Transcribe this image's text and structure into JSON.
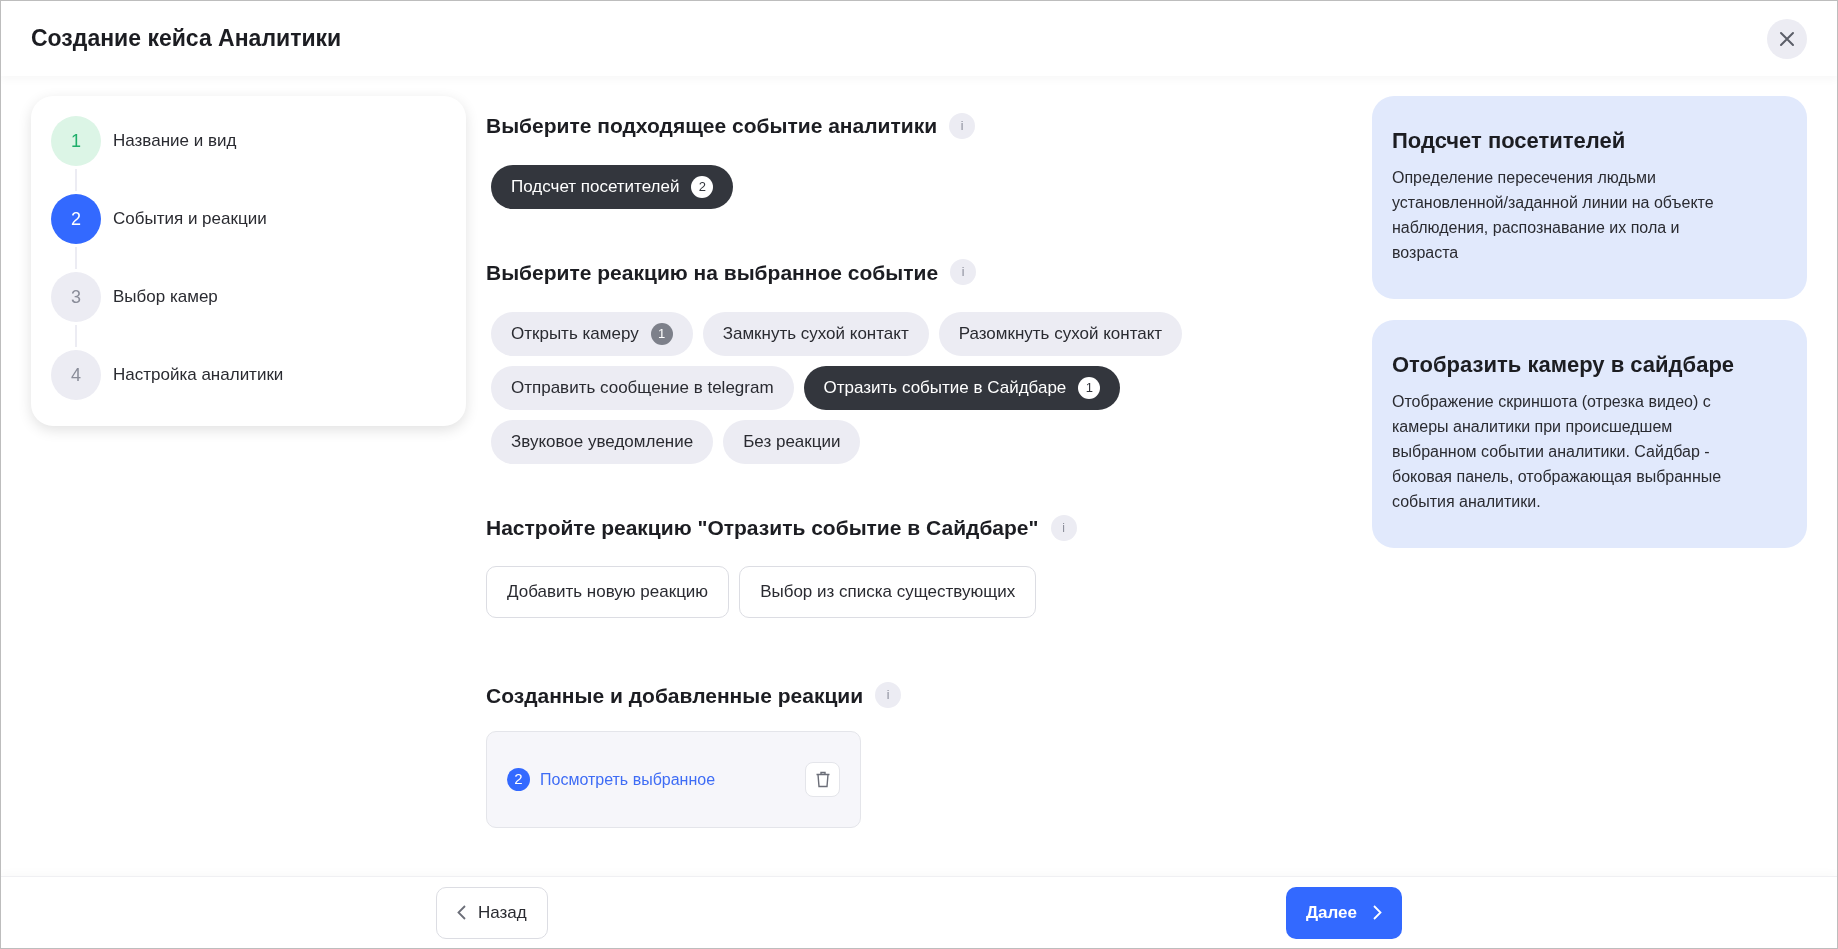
{
  "window": {
    "title": "Создание кейса Аналитики"
  },
  "steps": [
    {
      "number": "1",
      "label": "Название и вид",
      "completed": true,
      "selected": false
    },
    {
      "number": "2",
      "label": "События и реакции",
      "completed": false,
      "selected": true
    },
    {
      "number": "3",
      "label": "Выбор камер",
      "completed": false,
      "selected": false
    },
    {
      "number": "4",
      "label": "Настройка аналитики",
      "completed": false,
      "selected": false
    }
  ],
  "event_section": {
    "title": "Выберите подходящее событие аналитики",
    "info": "i",
    "chips": [
      {
        "label": "Подсчет посетителей",
        "badge": "2",
        "selected": true
      }
    ]
  },
  "reaction_section": {
    "title": "Выберите реакцию на выбранное событие",
    "info": "i",
    "chips": [
      {
        "label": "Открыть камеру",
        "badge": "1",
        "selected": false
      },
      {
        "label": "Замкнуть сухой контакт",
        "selected": false
      },
      {
        "label": "Разомкнуть сухой контакт",
        "selected": false
      },
      {
        "label": "Отправить сообщение в telegram",
        "selected": false
      },
      {
        "label": "Отразить событие в Сайдбаре",
        "badge": "1",
        "selected": true
      },
      {
        "label": "Звуковое уведомление",
        "selected": false
      },
      {
        "label": "Без реакции",
        "selected": false
      }
    ]
  },
  "configure_section": {
    "title": "Настройте реакцию \"Отразить событие в Сайдбаре\"",
    "info": "i",
    "buttons": [
      "Добавить новую реакцию",
      "Выбор из списка существующих"
    ]
  },
  "created_section": {
    "title": "Созданные и добавленные реакции",
    "info": "i",
    "item": {
      "count": "2",
      "link": "Посмотреть выбранное"
    }
  },
  "info_cards": [
    {
      "title": "Подсчет посетителей",
      "text": "Определение пересечения людьми установленной/заданной линии на объекте наблюдения, распознавание их пола и возраста"
    },
    {
      "title": "Отобразить камеру в сайдбаре",
      "text": "Отображение скриншота (отрезка видео) с камеры аналитики при происшедшем выбранном событии аналитики. Сайдбар - боковая панель, отображающая выбранные события аналитики."
    }
  ],
  "footer": {
    "back": "Назад",
    "next": "Далее"
  }
}
